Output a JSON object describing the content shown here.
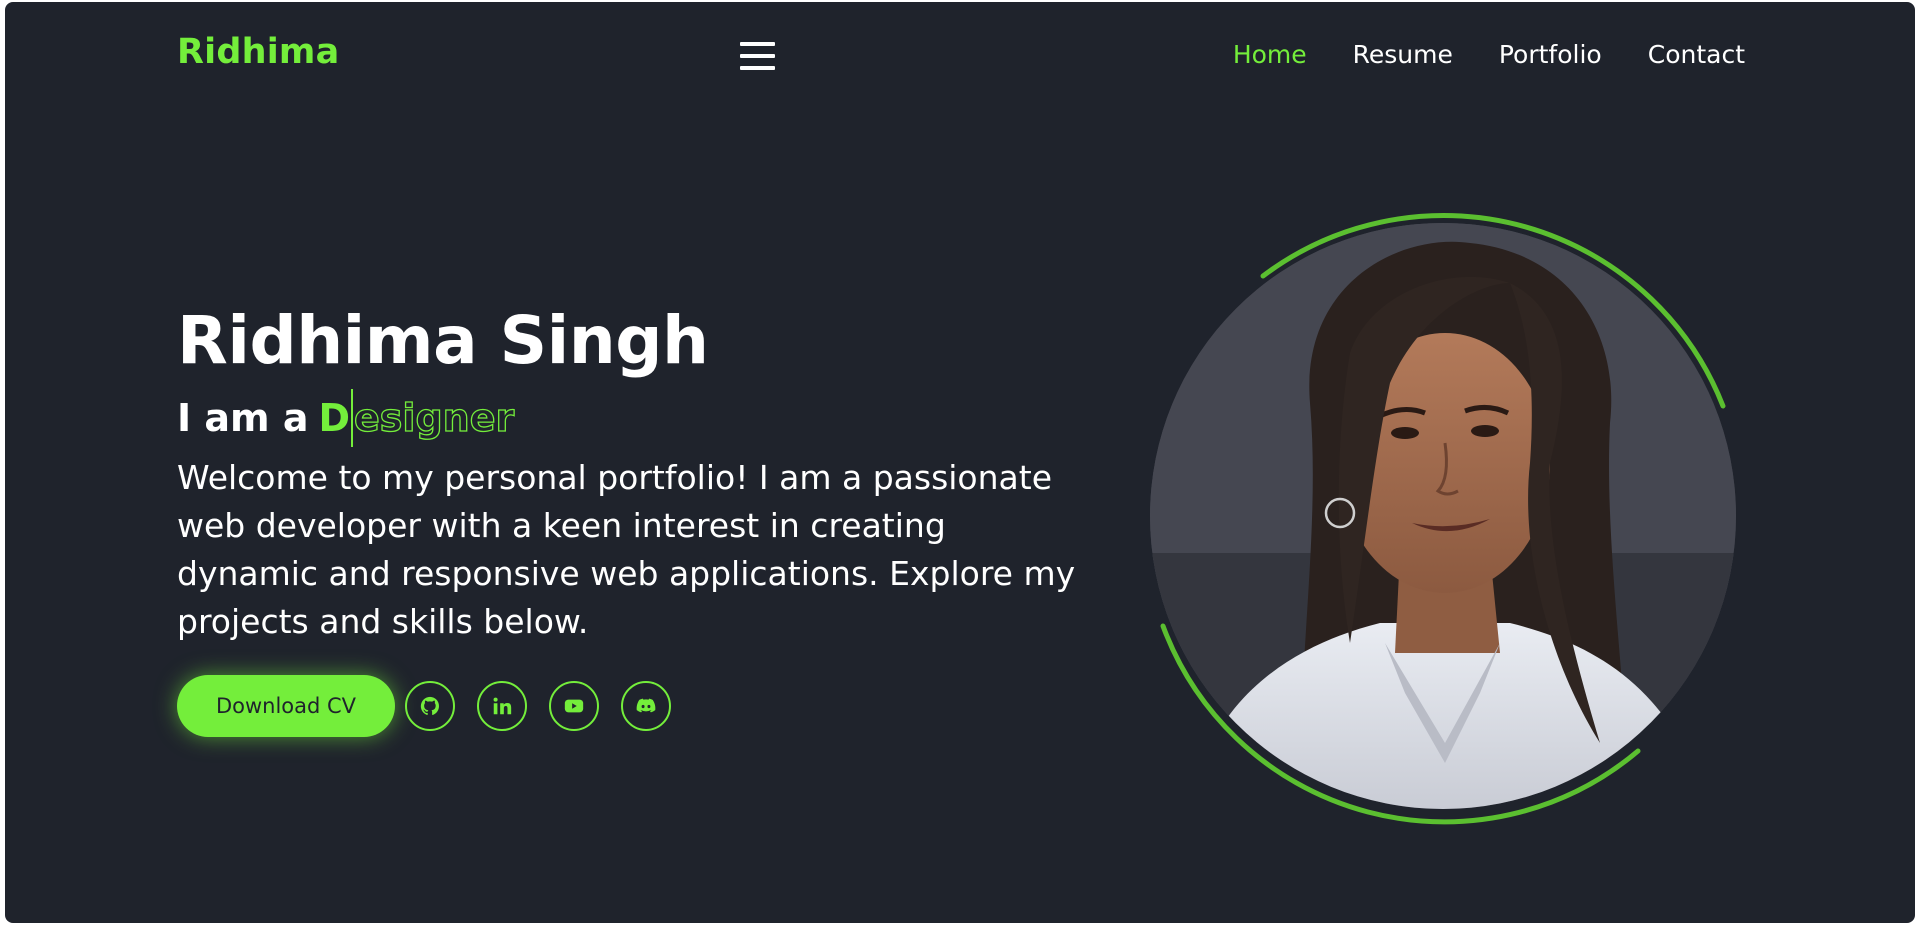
{
  "header": {
    "logo": "Ridhima",
    "menu_icon": "hamburger-icon",
    "nav": [
      {
        "label": "Home",
        "active": true
      },
      {
        "label": "Resume",
        "active": false
      },
      {
        "label": "Portfolio",
        "active": false
      },
      {
        "label": "Contact",
        "active": false
      }
    ]
  },
  "hero": {
    "name": "Ridhima Singh",
    "role_prefix": "I am a",
    "role_typed": "D",
    "role_remaining": "esigner",
    "description": "Welcome to my personal portfolio! I am a passionate web developer with a keen interest in creating dynamic and responsive web applications. Explore my projects and skills below.",
    "download_label": "Download CV",
    "socials": [
      {
        "icon": "github-icon"
      },
      {
        "icon": "linkedin-icon"
      },
      {
        "icon": "youtube-icon"
      },
      {
        "icon": "discord-icon"
      }
    ]
  },
  "colors": {
    "accent": "#74ee3b",
    "background": "#1f232c",
    "text": "#ffffff"
  }
}
